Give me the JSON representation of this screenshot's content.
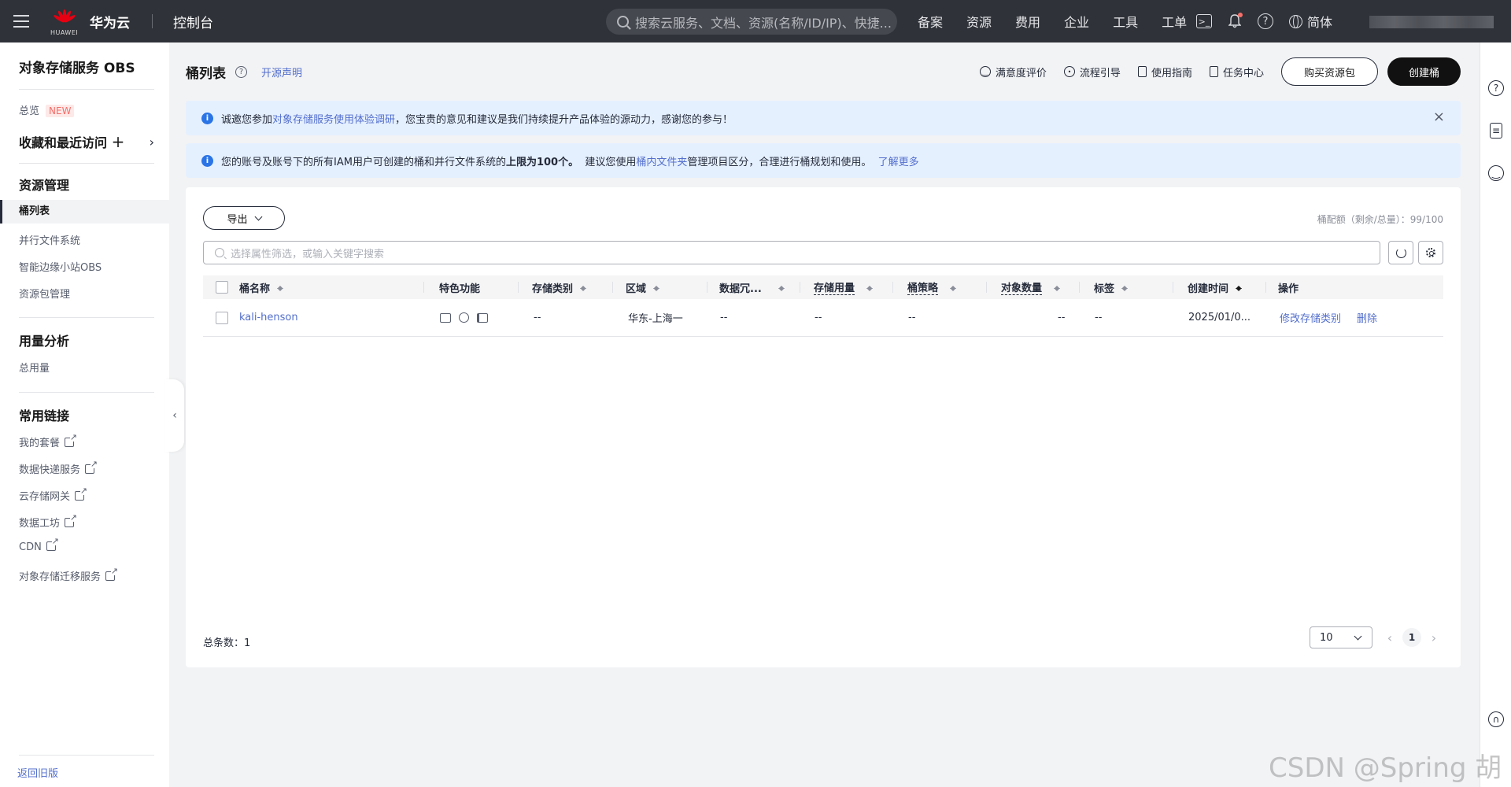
{
  "topbar": {
    "brand": "华为云",
    "logo_text": "HUAWEI",
    "console": "控制台",
    "search_placeholder": "搜索云服务、文档、资源(名称/ID/IP)、快捷...",
    "nav": [
      "备案",
      "资源",
      "费用",
      "企业",
      "工具",
      "工单"
    ],
    "lang": "简体"
  },
  "sidebar": {
    "title": "对象存储服务 OBS",
    "overview": "总览",
    "new_badge": "NEW",
    "favorites": "收藏和最近访问",
    "resource_section": "资源管理",
    "resource_items": [
      "桶列表",
      "并行文件系统",
      "智能边缘小站OBS",
      "资源包管理"
    ],
    "usage_section": "用量分析",
    "usage_items": [
      "总用量"
    ],
    "links_section": "常用链接",
    "link_items": [
      "我的套餐",
      "数据快递服务",
      "云存储网关",
      "数据工坊",
      "CDN",
      "对象存储迁移服务"
    ],
    "back": "返回旧版"
  },
  "header": {
    "title": "桶列表",
    "open_source": "开源声明",
    "links": [
      "满意度评价",
      "流程引导",
      "使用指南",
      "任务中心"
    ],
    "buy_button": "购买资源包",
    "create_button": "创建桶"
  },
  "alert1": {
    "prefix": "诚邀您参加",
    "link": "对象存储服务使用体验调研",
    "suffix": "，您宝贵的意见和建议是我们持续提升产品体验的源动力，感谢您的参与！"
  },
  "alert2": {
    "prefix": "您的账号及账号下的所有IAM用户可创建的桶和并行文件系统的",
    "bold": "上限为100个。",
    "mid": "建议您使用",
    "link": "桶内文件夹",
    "suffix": "管理项目区分，合理进行桶规划和使用。",
    "more": "了解更多"
  },
  "toolbar": {
    "export": "导出",
    "quota": "桶配额（剩余/总量）：99/100",
    "filter_placeholder": "选择属性筛选，或输入关键字搜索"
  },
  "table": {
    "headers": [
      "桶名称",
      "特色功能",
      "存储类别",
      "区域",
      "数据冗...",
      "存储用量",
      "桶策略",
      "对象数量",
      "标签",
      "创建时间",
      "操作"
    ],
    "rows": [
      {
        "name": "kali-henson",
        "storage_class": "--",
        "region": "华东-上海一",
        "redundancy": "--",
        "usage": "--",
        "policy": "--",
        "objects": "--",
        "tags": "--",
        "created": "2025/01/0...",
        "action_modify": "修改存储类别",
        "action_delete": "删除"
      }
    ]
  },
  "footer": {
    "total": "总条数：1",
    "page_size": "10",
    "current_page": "1"
  },
  "watermark": "CSDN @Spring  胡"
}
